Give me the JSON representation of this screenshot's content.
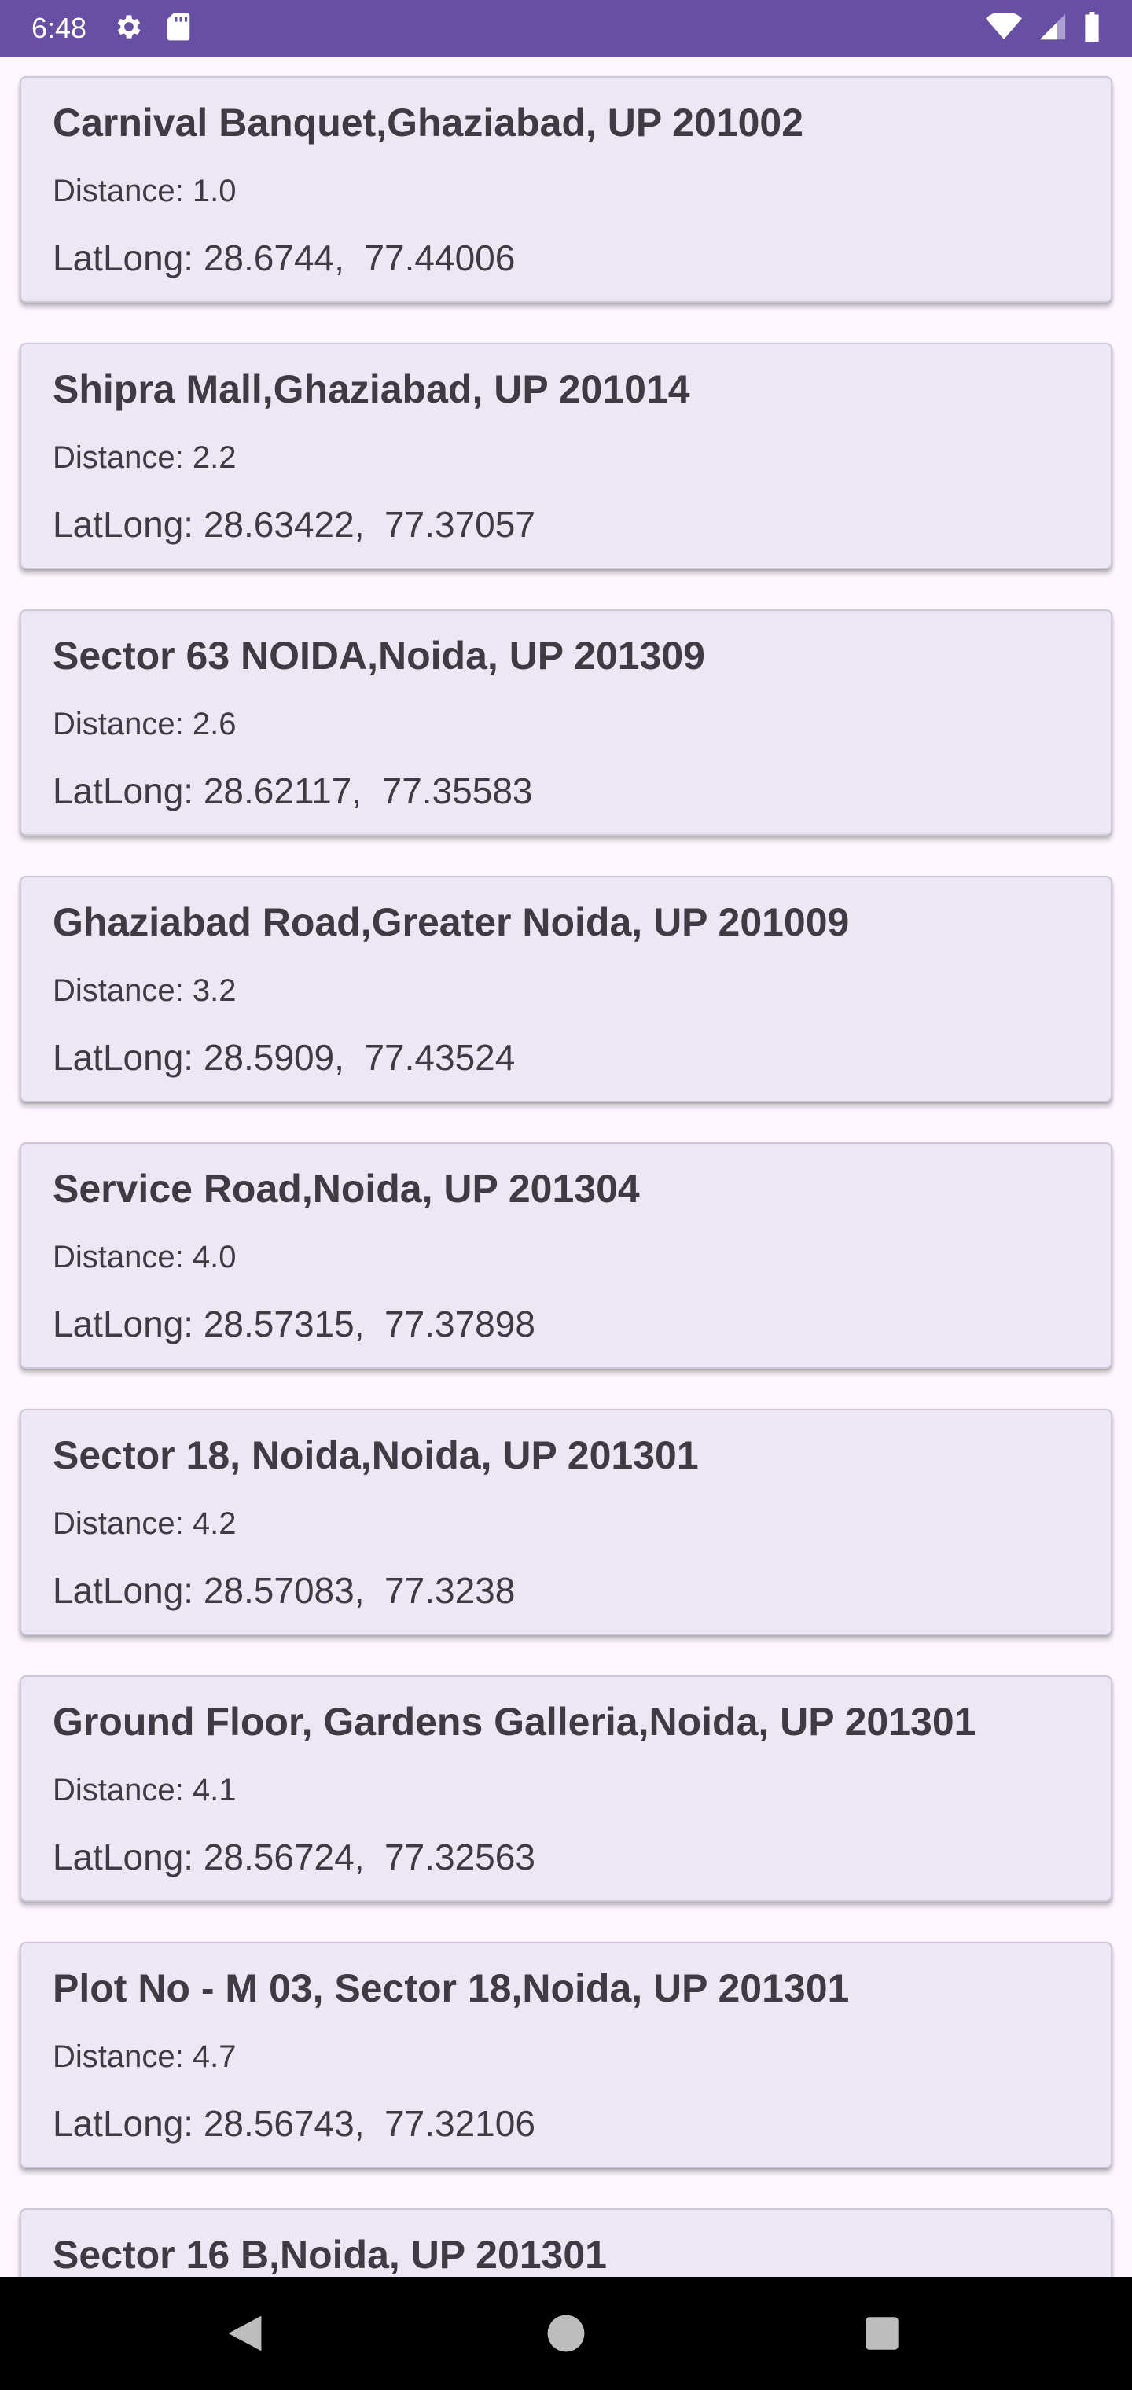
{
  "status_bar": {
    "time": "6:48",
    "left_icons": [
      "gear-icon",
      "sd-card-icon"
    ],
    "right_icons": [
      "wifi-icon",
      "cell-signal-icon",
      "battery-icon"
    ],
    "color": "#6750a4"
  },
  "locations": [
    {
      "title": "Carnival Banquet,Ghaziabad, UP 201002",
      "distance": "Distance: 1.0",
      "latlong": "LatLong: 28.6744,  77.44006"
    },
    {
      "title": "Shipra Mall,Ghaziabad, UP 201014",
      "distance": "Distance: 2.2",
      "latlong": "LatLong: 28.63422,  77.37057"
    },
    {
      "title": "Sector 63 NOIDA,Noida, UP 201309",
      "distance": "Distance: 2.6",
      "latlong": "LatLong: 28.62117,  77.35583"
    },
    {
      "title": "Ghaziabad Road,Greater Noida, UP 201009",
      "distance": "Distance: 3.2",
      "latlong": "LatLong: 28.5909,  77.43524"
    },
    {
      "title": "Service Road,Noida, UP 201304",
      "distance": "Distance: 4.0",
      "latlong": "LatLong: 28.57315,  77.37898"
    },
    {
      "title": "Sector 18, Noida,Noida, UP 201301",
      "distance": "Distance: 4.2",
      "latlong": "LatLong: 28.57083,  77.3238"
    },
    {
      "title": "Ground Floor, Gardens Galleria,Noida, UP 201301",
      "distance": "Distance: 4.1",
      "latlong": "LatLong: 28.56724,  77.32563"
    },
    {
      "title": "Plot No - M 03, Sector 18,Noida, UP 201301",
      "distance": "Distance: 4.7",
      "latlong": "LatLong: 28.56743,  77.32106"
    },
    {
      "title": "Sector 16 B,Noida, UP 201301",
      "distance": "",
      "latlong": ""
    }
  ],
  "nav_bar": {
    "buttons": [
      "back-icon",
      "home-icon",
      "recents-icon"
    ]
  }
}
